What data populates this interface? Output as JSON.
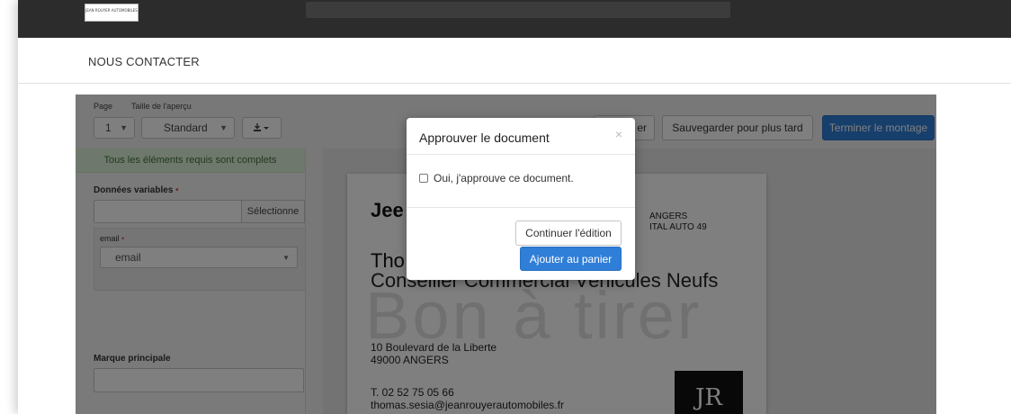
{
  "header": {
    "logo_text": "JEAN ROUYER AUTOMOBILES"
  },
  "subnav": {
    "contact_label": "NOUS CONTACTER"
  },
  "toolbar": {
    "page_label": "Page",
    "page_value": "1",
    "preview_size_label": "Taille de l'aperçu",
    "preview_size_value": "Standard",
    "continue_label_partial": "er",
    "save_later_label": "Sauvegarder pour plus tard",
    "finish_label": "Terminer le montage"
  },
  "left_panel": {
    "status_banner": "Tous les éléments requis sont complets",
    "variables_label": "Données variables",
    "required_marker": "•",
    "select_button": "Sélectionne",
    "email_label": "email",
    "email_value": "email",
    "brand_label": "Marque principale"
  },
  "card": {
    "brand_partial": "Jee",
    "right_line1": "ANGERS",
    "right_line2": "ITAL AUTO 49",
    "name_partial": "Tho",
    "title_visible": "Conseiller Commercial Véhicules Neufs",
    "watermark": "Bon à tirer",
    "address_line1": "10 Boulevard de la Liberte",
    "address_line2": "49000 ANGERS",
    "phone": "T. 02 52 75 05 66",
    "email": "thomas.sesia@jeanrouyerautomobiles.fr",
    "logo_text": "JR"
  },
  "modal": {
    "title": "Approuver le document",
    "close_glyph": "×",
    "checkbox_label": "Oui, j'approuve ce document.",
    "continue_button": "Continuer l'édition",
    "add_to_cart_button": "Ajouter au panier"
  },
  "colors": {
    "primary": "#2f7ed8",
    "topbar": "#2c2c2c",
    "success_bg": "#dff0d8",
    "success_text": "#3c763d",
    "required": "#d9534f"
  },
  "icons": {
    "download": "download-icon",
    "chevron": "chevron-down-icon",
    "close": "close-icon"
  }
}
